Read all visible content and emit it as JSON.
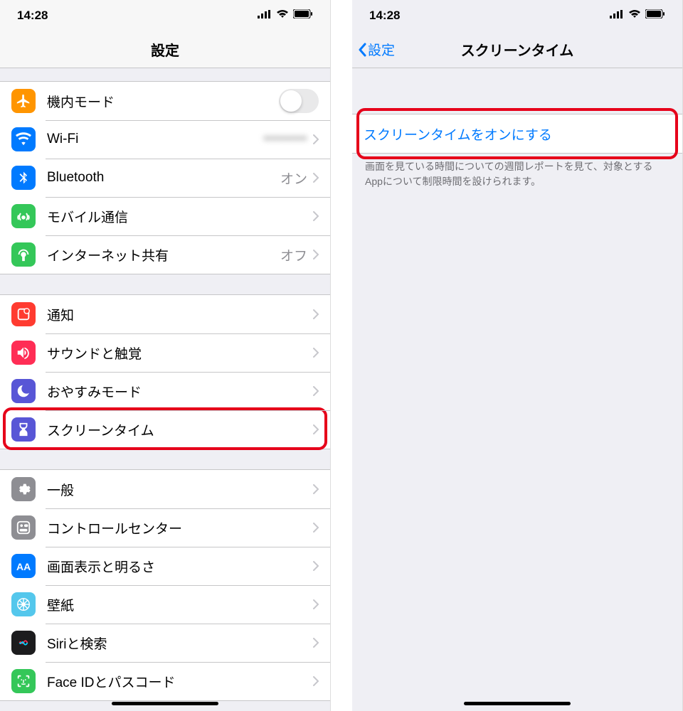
{
  "status": {
    "time": "14:28"
  },
  "left": {
    "title": "設定",
    "groups": [
      [
        {
          "icon": "airplane",
          "bg": "#ff9500",
          "label": "機内モード",
          "toggle": true
        },
        {
          "icon": "wifi",
          "bg": "#007aff",
          "label": "Wi-Fi",
          "value": "••••••••",
          "blur": true,
          "chevron": true
        },
        {
          "icon": "bluetooth",
          "bg": "#007aff",
          "label": "Bluetooth",
          "value": "オン",
          "chevron": true
        },
        {
          "icon": "cellular",
          "bg": "#34c759",
          "label": "モバイル通信",
          "chevron": true
        },
        {
          "icon": "hotspot",
          "bg": "#34c759",
          "label": "インターネット共有",
          "value": "オフ",
          "chevron": true
        }
      ],
      [
        {
          "icon": "notifications",
          "bg": "#ff3b30",
          "label": "通知",
          "chevron": true
        },
        {
          "icon": "sounds",
          "bg": "#ff2d55",
          "label": "サウンドと触覚",
          "chevron": true
        },
        {
          "icon": "dnd",
          "bg": "#5856d6",
          "label": "おやすみモード",
          "chevron": true
        },
        {
          "icon": "screentime",
          "bg": "#5856d6",
          "label": "スクリーンタイム",
          "chevron": true,
          "highlight": true
        }
      ],
      [
        {
          "icon": "general",
          "bg": "#8e8e93",
          "label": "一般",
          "chevron": true
        },
        {
          "icon": "controlcenter",
          "bg": "#8e8e93",
          "label": "コントロールセンター",
          "chevron": true
        },
        {
          "icon": "display",
          "bg": "#007aff",
          "label": "画面表示と明るさ",
          "chevron": true
        },
        {
          "icon": "wallpaper",
          "bg": "#54c7ec",
          "label": "壁紙",
          "chevron": true
        },
        {
          "icon": "siri",
          "bg": "#1c1c1e",
          "label": "Siriと検索",
          "chevron": true
        },
        {
          "icon": "faceid",
          "bg": "#34c759",
          "label": "Face IDとパスコード",
          "chevron": true
        }
      ]
    ]
  },
  "right": {
    "back": "設定",
    "title": "スクリーンタイム",
    "action": "スクリーンタイムをオンにする",
    "footer": "画面を見ている時間についての週間レポートを見て、対象とするAppについて制限時間を設けられます。"
  }
}
